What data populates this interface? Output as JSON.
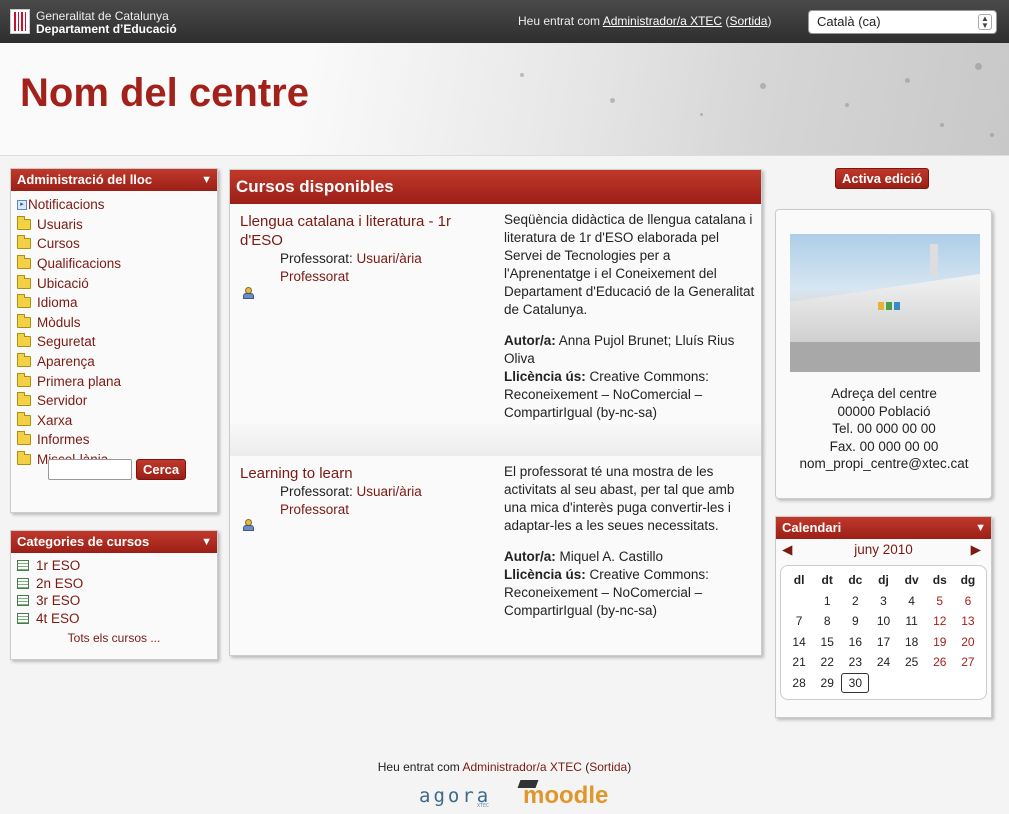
{
  "topbar": {
    "org_line1": "Generalitat de Catalunya",
    "org_line2": "Departament d’Educació",
    "logged_prefix": "Heu entrat com",
    "user": "Administrador/a XTEC",
    "logout": "Sortida",
    "language": "Català (ca)"
  },
  "header": {
    "site_title": "Nom del centre"
  },
  "admin": {
    "title": "Administració del lloc",
    "items": [
      "Notificacions",
      "Usuaris",
      "Cursos",
      "Qualificacions",
      "Ubicació",
      "Idioma",
      "Mòduls",
      "Seguretat",
      "Aparença",
      "Primera plana",
      "Servidor",
      "Xarxa",
      "Informes",
      "Miscel·lània"
    ],
    "search_button": "Cerca"
  },
  "categories": {
    "title": "Categories de cursos",
    "items": [
      "1r ESO",
      "2n ESO",
      "3r ESO",
      "4t ESO"
    ],
    "all_courses": "Tots els cursos ..."
  },
  "courses": {
    "title": "Cursos disponibles",
    "list": [
      {
        "name": "Llengua catalana i literatura - 1r d'ESO",
        "teacher_label": "Professorat:",
        "teacher": "Usuari/ària Professorat",
        "description": "Seqüència didàctica de llengua catalana i literatura de 1r d'ESO elaborada pel Servei de Tecnologies per a l'Aprenentatge i el Coneixement del Departament d'Educació de la Generalitat de Catalunya.",
        "author_label": "Autor/a:",
        "author": "Anna Pujol Brunet; Lluís Rius Oliva",
        "license_label": "Llicència ús:",
        "license": "Creative Commons: Reconeixement – NoComercial – CompartirIgual (by-nc-sa)"
      },
      {
        "name": "Learning to learn",
        "teacher_label": "Professorat:",
        "teacher": "Usuari/ària Professorat",
        "description": "El professorat té una mostra de les activitats al seu abast, per tal que amb una mica d'interès puga convertir-les i adaptar-les a les seues necessitats.",
        "author_label": "Autor/a:",
        "author": "Miquel A. Castillo",
        "license_label": "Llicència ús:",
        "license": "Creative Commons: Reconeixement – NoComercial – CompartirIgual (by-nc-sa)"
      }
    ]
  },
  "edit_button": "Activa edició",
  "center_info": {
    "lines": [
      "Adreça del centre",
      "00000 Població",
      "Tel. 00 000 00 00",
      "Fax. 00 000 00 00",
      "nom_propi_centre@xtec.cat"
    ]
  },
  "calendar": {
    "title": "Calendari",
    "month": "juny 2010",
    "weekdays": [
      "dl",
      "dt",
      "dc",
      "dj",
      "dv",
      "ds",
      "dg"
    ],
    "weeks": [
      [
        "",
        "1",
        "2",
        "3",
        "4",
        "5",
        "6"
      ],
      [
        "7",
        "8",
        "9",
        "10",
        "11",
        "12",
        "13"
      ],
      [
        "14",
        "15",
        "16",
        "17",
        "18",
        "19",
        "20"
      ],
      [
        "21",
        "22",
        "23",
        "24",
        "25",
        "26",
        "27"
      ],
      [
        "28",
        "29",
        "30",
        "",
        "",
        "",
        ""
      ]
    ],
    "today": "30"
  },
  "footer": {
    "logged_prefix": "Heu entrat com",
    "user": "Administrador/a XTEC",
    "logout": "Sortida",
    "logo_agora": "agora",
    "logo_agora_sub": "XTEC",
    "logo_moodle": "moodle"
  },
  "colors": {
    "brand_red": "#a3211b",
    "link": "#7a1a12"
  }
}
